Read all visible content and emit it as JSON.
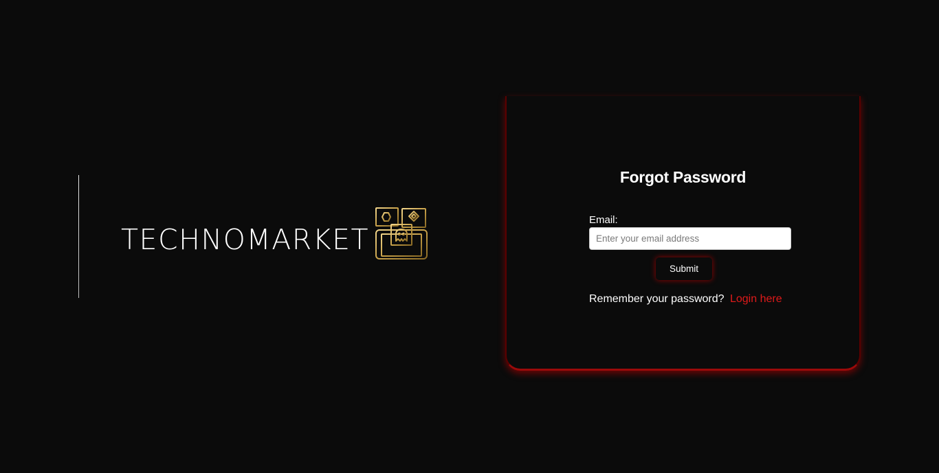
{
  "brand": {
    "name": "TECHNOMARKET",
    "icon": "game-devices-icon",
    "gold": "#c9a24a"
  },
  "card": {
    "title": "Forgot Password",
    "accent": "#9b0a0a"
  },
  "form": {
    "email_label": "Email:",
    "email_placeholder": "Enter your email address",
    "email_value": "",
    "submit_label": "Submit"
  },
  "footer": {
    "remember_text": "Remember your password?",
    "login_link": "Login here",
    "link_color": "#e01a1a"
  }
}
